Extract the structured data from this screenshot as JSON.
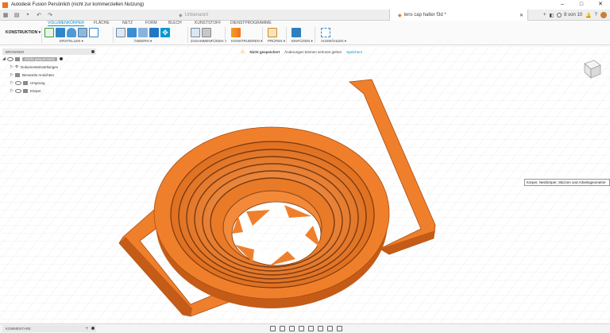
{
  "titlebar": {
    "title": "Autodesk Fusion Persönlich (nicht zur kommerziellen Nutzung)",
    "minimize": "–",
    "maximize": "□",
    "close": "✕"
  },
  "tabs": {
    "inactive_tab": "Unbenannt",
    "active_tab": "lens cap halter f3d *",
    "counter": "8 von 10"
  },
  "ribbon": {
    "workspace": "KONSTRUKTION ▾",
    "tabs": [
      "VOLUMENKÖRPER",
      "FLÄCHE",
      "NETZ",
      "FORM",
      "BLECH",
      "KUNSTSTOFF",
      "DIENSTPROGRAMME"
    ],
    "groups": {
      "create": "ERSTELLEN ▾",
      "modify": "ÄNDERN ▾",
      "assemble": "ZUSAMMENFÜGEN ▾",
      "construct": "KONSTRUIEREN ▾",
      "inspect": "PRÜFEN ▾",
      "insert": "EINFÜGEN ▾",
      "select": "AUSWÄHLEN ▾"
    }
  },
  "browser": {
    "title": "BROWSER",
    "root": "(Nicht gespeichert)",
    "items": [
      "Dokumenteinstellungen",
      "Benannte Ansichten",
      "Ursprung",
      "Körper"
    ]
  },
  "notice": {
    "status": "Nicht gespeichert",
    "message": "Änderungen können verloren gehen",
    "action": "Speichern"
  },
  "tooltip": "Körper, Netzkörper, Skizzen und Arbeitsgeometrie",
  "bottom": {
    "comments": "KOMMENTARE"
  },
  "colors": {
    "model": "#f07f2c",
    "model_dark": "#c45c17",
    "accent": "#0696d7",
    "logo": "#f37021"
  }
}
